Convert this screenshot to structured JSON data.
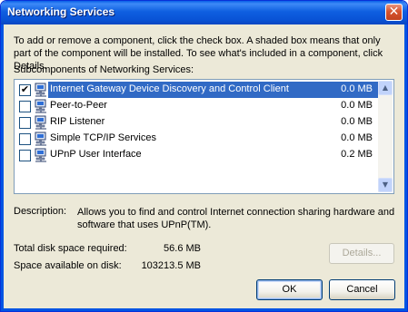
{
  "window": {
    "title": "Networking Services",
    "close_glyph": "✕"
  },
  "intro_text": "To add or remove a component, click the check box. A shaded box means that only part of the component will be installed. To see what's included in a component, click Details.",
  "subcomponents_label": "Subcomponents of Networking Services:",
  "components": [
    {
      "name": "Internet Gateway Device Discovery and Control Client",
      "size": "0.0 MB",
      "checked": true,
      "selected": true,
      "icon": "network-computer-icon"
    },
    {
      "name": "Peer-to-Peer",
      "size": "0.0 MB",
      "checked": false,
      "selected": false,
      "icon": "network-computer-icon"
    },
    {
      "name": "RIP Listener",
      "size": "0.0 MB",
      "checked": false,
      "selected": false,
      "icon": "network-computer-icon"
    },
    {
      "name": "Simple TCP/IP Services",
      "size": "0.0 MB",
      "checked": false,
      "selected": false,
      "icon": "network-computer-icon"
    },
    {
      "name": "UPnP User Interface",
      "size": "0.2 MB",
      "checked": false,
      "selected": false,
      "icon": "network-computer-icon"
    }
  ],
  "description": {
    "label": "Description:",
    "text": "Allows you to find and control Internet connection sharing hardware and software that uses UPnP(TM)."
  },
  "disk": {
    "required_label": "Total disk space required:",
    "required_value": "56.6 MB",
    "available_label": "Space available on disk:",
    "available_value": "103213.5 MB"
  },
  "buttons": {
    "details": "Details...",
    "ok": "OK",
    "cancel": "Cancel"
  },
  "colors": {
    "titlebar": "#0a5fe8",
    "selection": "#316ac5",
    "dialog_bg": "#ece9d8"
  }
}
